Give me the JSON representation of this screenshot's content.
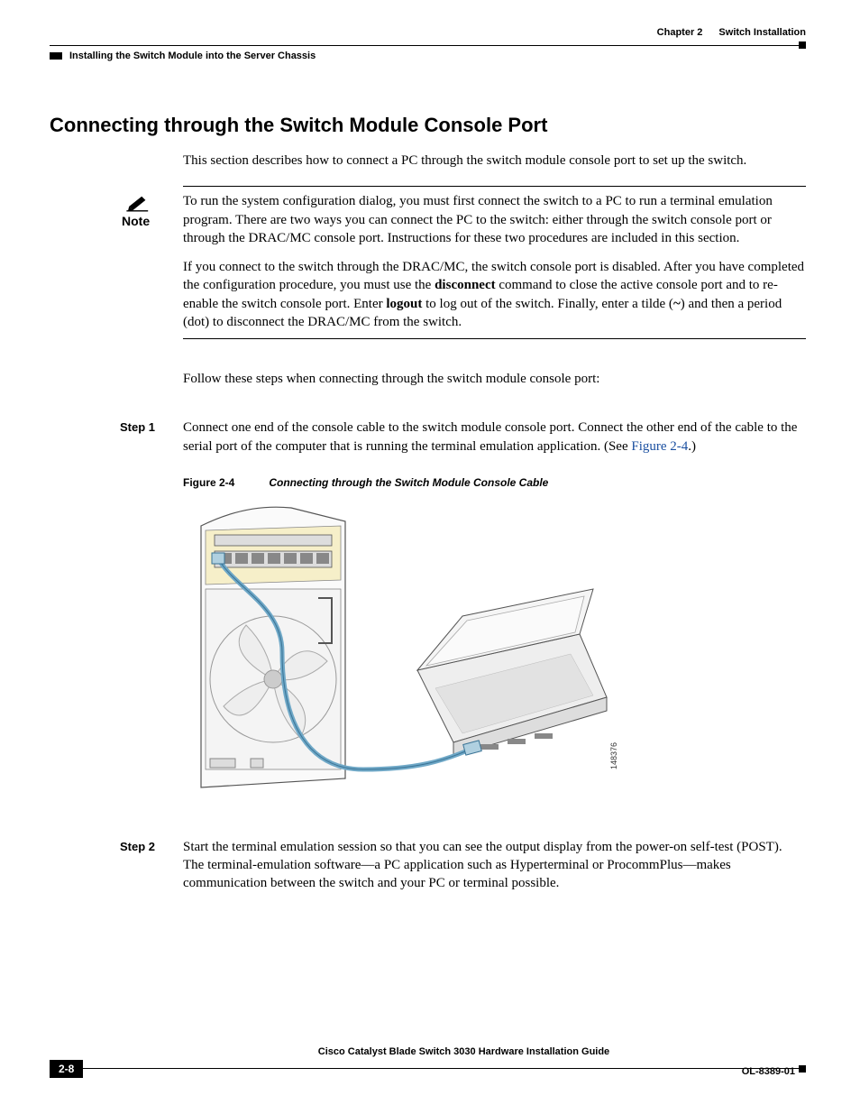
{
  "header": {
    "chapter": "Chapter 2",
    "chapter_title": "Switch Installation",
    "section_path": "Installing the Switch Module into the Server Chassis"
  },
  "heading": "Connecting through the Switch Module Console Port",
  "intro": "This section describes how to connect a PC through the switch module console port to set up the switch.",
  "note": {
    "label": "Note",
    "p1_a": "To run the system configuration dialog, you must first connect the switch to a PC to run a terminal emulation program. There are two ways you can connect the PC to the switch: either through the switch console port or through the DRAC/MC console port. Instructions for these two procedures are included in this section.",
    "p2_a": "If you connect to the switch through the DRAC/MC, the switch console port is disabled. After you have completed the configuration procedure, you must use the ",
    "p2_b": "disconnect",
    "p2_c": " command to close the active console port and to re-enable the switch console port. Enter ",
    "p2_d": "logout",
    "p2_e": " to log out of the switch. Finally, enter a tilde (",
    "p2_f": "~",
    "p2_g": ") and then a period (dot) to disconnect the DRAC/MC from the switch."
  },
  "follow": "Follow these steps when connecting through the switch module console port:",
  "steps": {
    "s1_label": "Step 1",
    "s1_a": "Connect one end of the console cable to the switch module console port. Connect the other end of the cable to the serial port of the computer that is running the terminal emulation application. (See ",
    "s1_link": "Figure 2-4",
    "s1_b": ".)",
    "s2_label": "Step 2",
    "s2": "Start the terminal emulation session so that you can see the output display from the power-on self-test (POST). The terminal-emulation software—a PC application such as Hyperterminal or ProcommPlus—makes communication between the switch and your PC or terminal possible."
  },
  "figure": {
    "num": "Figure 2-4",
    "caption": "Connecting through the Switch Module Console Cable",
    "id": "148376"
  },
  "footer": {
    "book": "Cisco Catalyst Blade Switch 3030 Hardware Installation Guide",
    "page": "2-8",
    "docnum": "OL-8389-01"
  }
}
